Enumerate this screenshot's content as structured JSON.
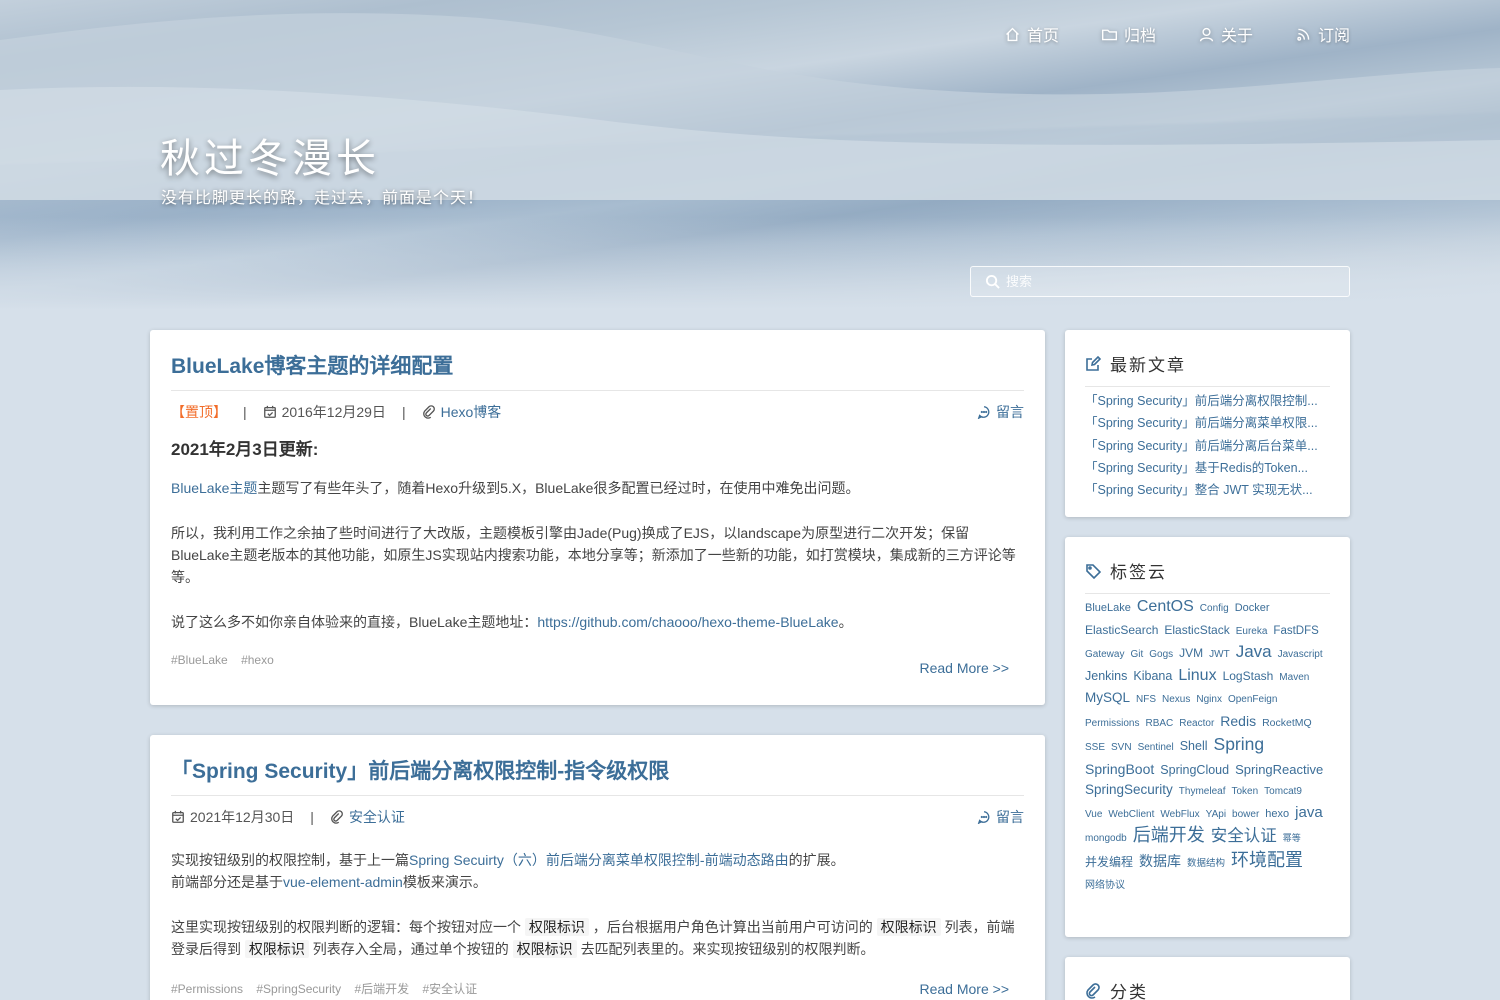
{
  "nav": [
    {
      "label": "首页",
      "icon": "home-icon"
    },
    {
      "label": "归档",
      "icon": "folder-icon"
    },
    {
      "label": "关于",
      "icon": "user-icon"
    },
    {
      "label": "订阅",
      "icon": "rss-icon"
    }
  ],
  "site": {
    "title": "秋过冬漫长",
    "subtitle": "没有比脚更长的路，走过去，前面是个天！"
  },
  "search": {
    "placeholder": "搜索"
  },
  "posts": [
    {
      "title": "BlueLake博客主题的详细配置",
      "sticky": "【置顶】",
      "sep": "|",
      "date": "2016年12月29日",
      "category": "Hexo博客",
      "comment": "留言",
      "heading": "2021年2月3日更新:",
      "p1_link": "BlueLake主题",
      "p1_text": "主题写了有些年头了，随着Hexo升级到5.X，BlueLake很多配置已经过时，在使用中难免出问题。",
      "p2": "所以，我利用工作之余抽了些时间进行了大改版，主题模板引擎由Jade(Pug)换成了EJS，以landscape为原型进行二次开发；保留BlueLake主题老版本的其他功能，如原生JS实现站内搜索功能，本地分享等；新添加了一些新的功能，如打赏模块，集成新的三方评论等等。",
      "p3_text": "说了这么多不如你亲自体验来的直接，BlueLake主题地址：",
      "p3_link": "https://github.com/chaooo/hexo-theme-BlueLake",
      "p3_end": "。",
      "tags": [
        "#BlueLake",
        "#hexo"
      ],
      "read_more": "Read More >>"
    },
    {
      "title": "「Spring Security」前后端分离权限控制-指令级权限",
      "sep": "|",
      "date": "2021年12月30日",
      "category": "安全认证",
      "comment": "留言",
      "p1_a": "实现按钮级别的权限控制，基于上一篇",
      "p1_link": "Spring Secuirty（六）前后端分离菜单权限控制-前端动态路由",
      "p1_b": "的扩展。",
      "p1_c": "前端部分还是基于",
      "p1_link2": "vue-element-admin",
      "p1_d": "模板来演示。",
      "p2_a": "这里实现按钮级别的权限判断的逻辑：每个按钮对应一个",
      "code": "权限标识",
      "p2_b": "，后台根据用户角色计算出当前用户可访问的",
      "p2_c": "列表，前端登录后得到",
      "p2_d": "列表存入全局，通过单个按钮的",
      "p2_e": "去匹配列表里的。来实现按钮级别的权限判断。",
      "tags": [
        "#Permissions",
        "#SpringSecurity",
        "#后端开发",
        "#安全认证"
      ],
      "read_more": "Read More >>"
    }
  ],
  "recent": {
    "title": "最新文章",
    "items": [
      "「Spring Security」前后端分离权限控制...",
      "「Spring Security」前后端分离菜单权限...",
      "「Spring Security」前后端分离后台菜单...",
      "「Spring Security」基于Redis的Token...",
      "「Spring Security」整合 JWT 实现无状..."
    ]
  },
  "tag_cloud": {
    "title": "标签云",
    "tags": [
      {
        "label": "BlueLake",
        "size": 11
      },
      {
        "label": "CentOS",
        "size": 16
      },
      {
        "label": "Config",
        "size": 10
      },
      {
        "label": "Docker",
        "size": 11
      },
      {
        "label": "ElasticSearch",
        "size": 12
      },
      {
        "label": "ElasticStack",
        "size": 12
      },
      {
        "label": "Eureka",
        "size": 10
      },
      {
        "label": "FastDFS",
        "size": 11.5
      },
      {
        "label": "Gateway",
        "size": 10
      },
      {
        "label": "Git",
        "size": 10
      },
      {
        "label": "Gogs",
        "size": 10
      },
      {
        "label": "JVM",
        "size": 12
      },
      {
        "label": "JWT",
        "size": 10
      },
      {
        "label": "Java",
        "size": 17
      },
      {
        "label": "Javascript",
        "size": 10
      },
      {
        "label": "Jenkins",
        "size": 12.5
      },
      {
        "label": "Kibana",
        "size": 12.5
      },
      {
        "label": "Linux",
        "size": 16
      },
      {
        "label": "LogStash",
        "size": 12
      },
      {
        "label": "Maven",
        "size": 10
      },
      {
        "label": "MySQL",
        "size": 13.5
      },
      {
        "label": "NFS",
        "size": 10
      },
      {
        "label": "Nexus",
        "size": 10
      },
      {
        "label": "Nginx",
        "size": 10
      },
      {
        "label": "OpenFeign",
        "size": 10
      },
      {
        "label": "Permissions",
        "size": 10
      },
      {
        "label": "RBAC",
        "size": 10
      },
      {
        "label": "Reactor",
        "size": 10
      },
      {
        "label": "Redis",
        "size": 14
      },
      {
        "label": "RocketMQ",
        "size": 10.5
      },
      {
        "label": "SSE",
        "size": 10
      },
      {
        "label": "SVN",
        "size": 10
      },
      {
        "label": "Sentinel",
        "size": 10
      },
      {
        "label": "Shell",
        "size": 12.5
      },
      {
        "label": "Spring",
        "size": 17.5
      },
      {
        "label": "SpringBoot",
        "size": 14
      },
      {
        "label": "SpringCloud",
        "size": 12.5
      },
      {
        "label": "SpringReactive",
        "size": 13
      },
      {
        "label": "SpringSecurity",
        "size": 13.5
      },
      {
        "label": "Thymeleaf",
        "size": 10
      },
      {
        "label": "Token",
        "size": 10
      },
      {
        "label": "Tomcat9",
        "size": 10
      },
      {
        "label": "Vue",
        "size": 10
      },
      {
        "label": "WebClient",
        "size": 10
      },
      {
        "label": "WebFlux",
        "size": 10
      },
      {
        "label": "YApi",
        "size": 10
      },
      {
        "label": "bower",
        "size": 10
      },
      {
        "label": "hexo",
        "size": 11
      },
      {
        "label": "java",
        "size": 15
      },
      {
        "label": "mongodb",
        "size": 10
      },
      {
        "label": "后端开发",
        "size": 18
      },
      {
        "label": "安全认证",
        "size": 16.5
      },
      {
        "label": "幂等",
        "size": 9
      },
      {
        "label": "并发编程",
        "size": 12
      },
      {
        "label": "数据库",
        "size": 14
      },
      {
        "label": "数据结构",
        "size": 9.5
      },
      {
        "label": "环境配置",
        "size": 18
      },
      {
        "label": "网络协议",
        "size": 10
      }
    ]
  },
  "categories": {
    "title": "分类"
  }
}
